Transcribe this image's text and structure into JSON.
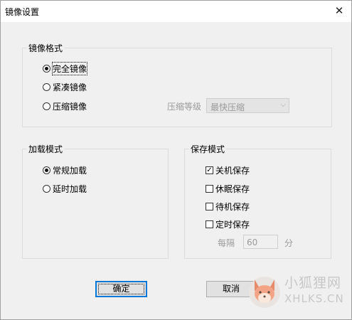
{
  "window": {
    "title": "镜像设置",
    "close_label": "✕"
  },
  "mirror_format": {
    "legend": "镜像格式",
    "options": [
      {
        "label": "完全镜像",
        "selected": true
      },
      {
        "label": "紧凑镜像",
        "selected": false
      },
      {
        "label": "压缩镜像",
        "selected": false
      }
    ],
    "compression_label": "压缩等级",
    "compression_value": "最快压缩"
  },
  "load_mode": {
    "legend": "加载模式",
    "options": [
      {
        "label": "常规加载",
        "selected": true
      },
      {
        "label": "延时加载",
        "selected": false
      }
    ]
  },
  "save_mode": {
    "legend": "保存模式",
    "options": [
      {
        "label": "关机保存",
        "checked": true
      },
      {
        "label": "休眠保存",
        "checked": false
      },
      {
        "label": "待机保存",
        "checked": false
      },
      {
        "label": "定时保存",
        "checked": false
      }
    ],
    "interval_prefix": "每隔",
    "interval_value": "60",
    "interval_unit": "分"
  },
  "buttons": {
    "ok": "确定",
    "cancel": "取消"
  },
  "watermark": {
    "cn": "小狐狸网",
    "en": "XHLKS.CN"
  }
}
